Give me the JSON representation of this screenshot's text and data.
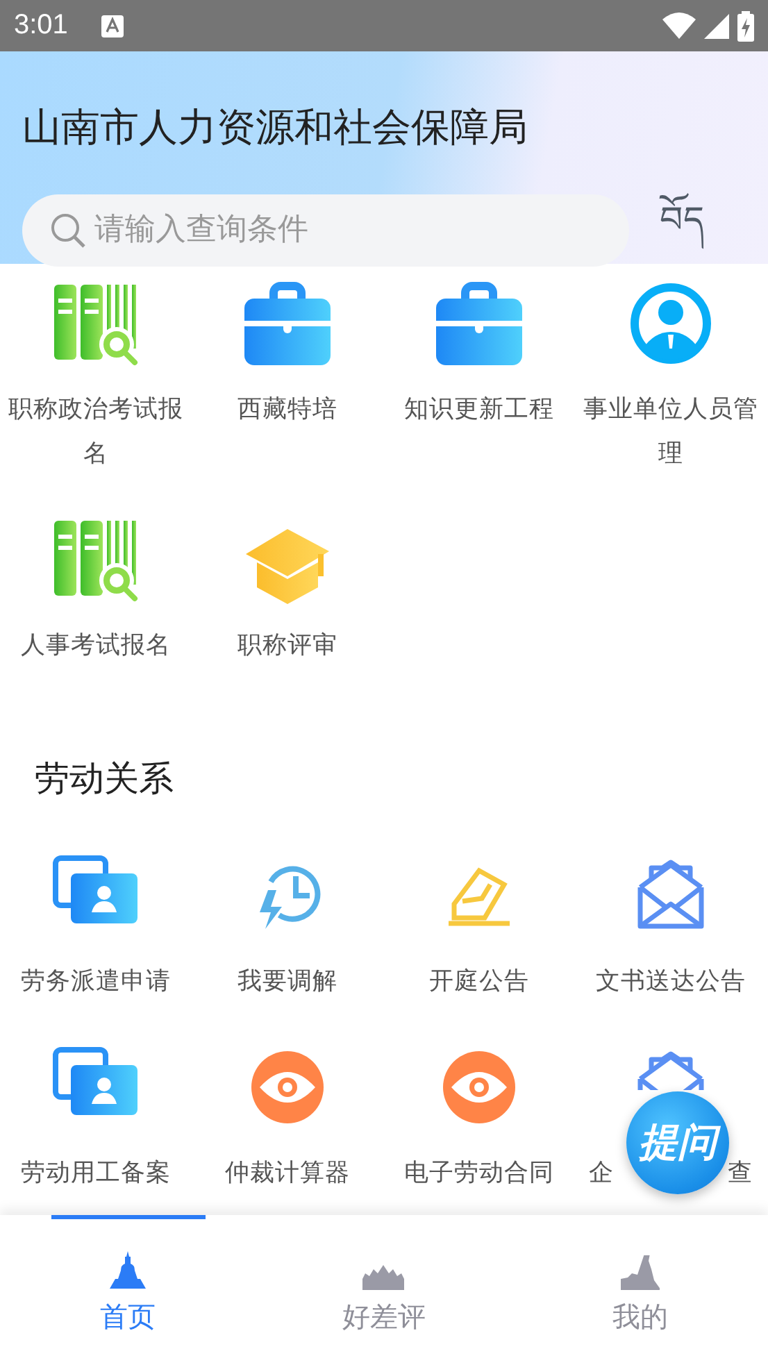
{
  "status_bar": {
    "time": "3:01"
  },
  "header": {
    "title": "山南市人力资源和社会保障局",
    "search": {
      "placeholder": "请输入查询条件"
    },
    "language_button": "བོད"
  },
  "services": [
    {
      "label": "职称政治考试报名",
      "kind": "books"
    },
    {
      "label": "西藏特培",
      "kind": "briefcase"
    },
    {
      "label": "知识更新工程",
      "kind": "briefcase"
    },
    {
      "label": "事业单位人员管理",
      "kind": "person"
    },
    {
      "label": "人事考试报名",
      "kind": "books"
    },
    {
      "label": "职称评审",
      "kind": "cap"
    }
  ],
  "labor_section": {
    "title": "劳动关系",
    "items": [
      {
        "label": "劳务派遣申请",
        "kind": "contacts"
      },
      {
        "label": "我要调解",
        "kind": "clock"
      },
      {
        "label": "开庭公告",
        "kind": "letter"
      },
      {
        "label": "文书送达公告",
        "kind": "envelope"
      },
      {
        "label": "劳动用工备案",
        "kind": "contacts"
      },
      {
        "label": "仲裁计算器",
        "kind": "eye"
      },
      {
        "label": "电子劳动合同",
        "kind": "eye"
      },
      {
        "label": "企",
        "label_end": "查",
        "kind": "envelope"
      }
    ]
  },
  "ask_button": {
    "label": "提问"
  },
  "tabs": [
    {
      "label": "首页",
      "kind": "stupa",
      "selected": true
    },
    {
      "label": "好差评",
      "kind": "palace",
      "selected": false
    },
    {
      "label": "我的",
      "kind": "rock",
      "selected": false
    }
  ]
}
